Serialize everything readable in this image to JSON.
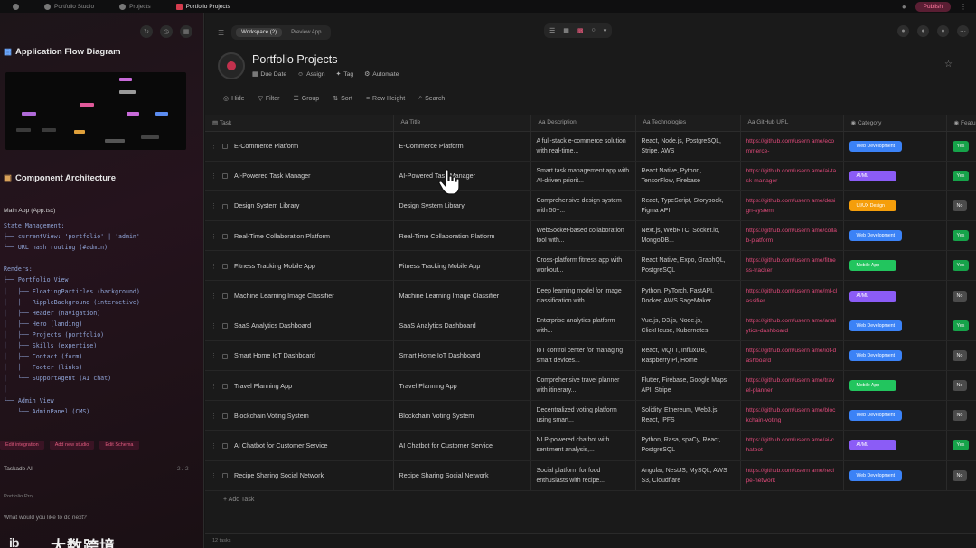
{
  "topbar": {
    "tabs": [
      {
        "label": "Portfolio Studio",
        "active": false
      },
      {
        "label": "Projects",
        "active": false
      },
      {
        "label": "Portfolio Projects",
        "active": true
      }
    ],
    "publish_label": "Publish"
  },
  "left": {
    "diagram_heading": "Application Flow Diagram",
    "component_heading": "Component Architecture",
    "main_app": "Main App (App.tsx)",
    "code_lines": [
      "State Management:",
      "├── currentView: 'portfolio' | 'admin'",
      "└── URL hash routing (#admin)",
      "",
      "Renders:",
      "├── Portfolio View",
      "│   ├── FloatingParticles (background)",
      "│   ├── RippleBackground (interactive)",
      "│   ├── Header (navigation)",
      "│   ├── Hero (landing)",
      "│   ├── Projects (portfolio)",
      "│   ├── Skills (expertise)",
      "│   ├── Contact (form)",
      "│   ├── Footer (links)",
      "│   └── SupportAgent (AI chat)",
      "│",
      "└── Admin View",
      "    └── AdminPanel (CMS)"
    ],
    "chips": [
      "Edit integration",
      "Add new studio",
      "Edit Schema"
    ],
    "ai_label": "Taskade AI",
    "ai_count": "2 / 2",
    "ai_sub": "Portfolio Proj...",
    "ai_question": "What would you like to do next?",
    "watermark_text": "大数跨境",
    "watermark_logo": "ib"
  },
  "toolbar": {
    "workspace_label": "Workspace (2)",
    "preview_label": "Preview App"
  },
  "project": {
    "title": "Portfolio Projects",
    "props": [
      "Due Date",
      "Assign",
      "Tag",
      "Automate"
    ],
    "filters": [
      "Hide",
      "Filter",
      "Group",
      "Sort",
      "Row Height",
      "Search"
    ],
    "add_task": "Add Task",
    "footer_count": "12 tasks"
  },
  "columns": [
    "Task",
    "Title",
    "Description",
    "Technologies",
    "GitHub URL",
    "Category",
    "Featured"
  ],
  "colors": {
    "web": "#3b82f6",
    "ai": "#8b5cf6",
    "mobile": "#22c55e",
    "design": "#f59e0b",
    "yes": "#16a34a",
    "no": "#4b4b4b",
    "accent": "#e0497a"
  },
  "rows": [
    {
      "task": "E-Commerce Platform",
      "title": "E-Commerce Platform",
      "desc": "A full-stack e-commerce solution with real-time...",
      "tech": "React, Node.js, PostgreSQL, Stripe, AWS",
      "url": "https://github.com/usern ame/ecommerce-",
      "category": "Web Development",
      "cat_color": "web",
      "featured": "Yes"
    },
    {
      "task": "AI-Powered Task Manager",
      "title": "AI-Powered Task Manager",
      "desc": "Smart task management app with AI-driven priorit...",
      "tech": "React Native, Python, TensorFlow, Firebase",
      "url": "https://github.com/usern ame/ai-task-manager",
      "category": "AI/ML",
      "cat_color": "ai",
      "featured": "Yes"
    },
    {
      "task": "Design System Library",
      "title": "Design System Library",
      "desc": "Comprehensive design system with 50+...",
      "tech": "React, TypeScript, Storybook, Figma API",
      "url": "https://github.com/usern ame/design-system",
      "category": "UI/UX Design",
      "cat_color": "design",
      "featured": "No"
    },
    {
      "task": "Real-Time Collaboration Platform",
      "title": "Real-Time Collaboration Platform",
      "desc": "WebSocket-based collaboration tool with...",
      "tech": "Next.js, WebRTC, Socket.io, MongoDB...",
      "url": "https://github.com/usern ame/collab-platform",
      "category": "Web Development",
      "cat_color": "web",
      "featured": "Yes"
    },
    {
      "task": "Fitness Tracking Mobile App",
      "title": "Fitness Tracking Mobile App",
      "desc": "Cross-platform fitness app with workout...",
      "tech": "React Native, Expo, GraphQL, PostgreSQL",
      "url": "https://github.com/usern ame/fitness-tracker",
      "category": "Mobile App",
      "cat_color": "mobile",
      "featured": "Yes"
    },
    {
      "task": "Machine Learning Image Classifier",
      "title": "Machine Learning Image Classifier",
      "desc": "Deep learning model for image classification with...",
      "tech": "Python, PyTorch, FastAPI, Docker, AWS SageMaker",
      "url": "https://github.com/usern ame/ml-classifier",
      "category": "AI/ML",
      "cat_color": "ai",
      "featured": "No"
    },
    {
      "task": "SaaS Analytics Dashboard",
      "title": "SaaS Analytics Dashboard",
      "desc": "Enterprise analytics platform with...",
      "tech": "Vue.js, D3.js, Node.js, ClickHouse, Kubernetes",
      "url": "https://github.com/usern ame/analytics-dashboard",
      "category": "Web Development",
      "cat_color": "web",
      "featured": "Yes"
    },
    {
      "task": "Smart Home IoT Dashboard",
      "title": "Smart Home IoT Dashboard",
      "desc": "IoT control center for managing smart devices...",
      "tech": "React, MQTT, InfluxDB, Raspberry Pi, Home",
      "url": "https://github.com/usern ame/iot-dashboard",
      "category": "Web Development",
      "cat_color": "web",
      "featured": "No"
    },
    {
      "task": "Travel Planning App",
      "title": "Travel Planning App",
      "desc": "Comprehensive travel planner with itinerary...",
      "tech": "Flutter, Firebase, Google Maps API, Stripe",
      "url": "https://github.com/usern ame/travel-planner",
      "category": "Mobile App",
      "cat_color": "mobile",
      "featured": "No"
    },
    {
      "task": "Blockchain Voting System",
      "title": "Blockchain Voting System",
      "desc": "Decentralized voting platform using smart...",
      "tech": "Solidity, Ethereum, Web3.js, React, IPFS",
      "url": "https://github.com/usern ame/blockchain-voting",
      "category": "Web Development",
      "cat_color": "web",
      "featured": "No"
    },
    {
      "task": "AI Chatbot for Customer Service",
      "title": "AI Chatbot for Customer Service",
      "desc": "NLP-powered chatbot with sentiment analysis,...",
      "tech": "Python, Rasa, spaCy, React, PostgreSQL",
      "url": "https://github.com/usern ame/ai-chatbot",
      "category": "AI/ML",
      "cat_color": "ai",
      "featured": "Yes"
    },
    {
      "task": "Recipe Sharing Social Network",
      "title": "Recipe Sharing Social Network",
      "desc": "Social platform for food enthusiasts with recipe...",
      "tech": "Angular, NestJS, MySQL, AWS S3, Cloudflare",
      "url": "https://github.com/usern ame/recipe-network",
      "category": "Web Development",
      "cat_color": "web",
      "featured": "No"
    }
  ]
}
